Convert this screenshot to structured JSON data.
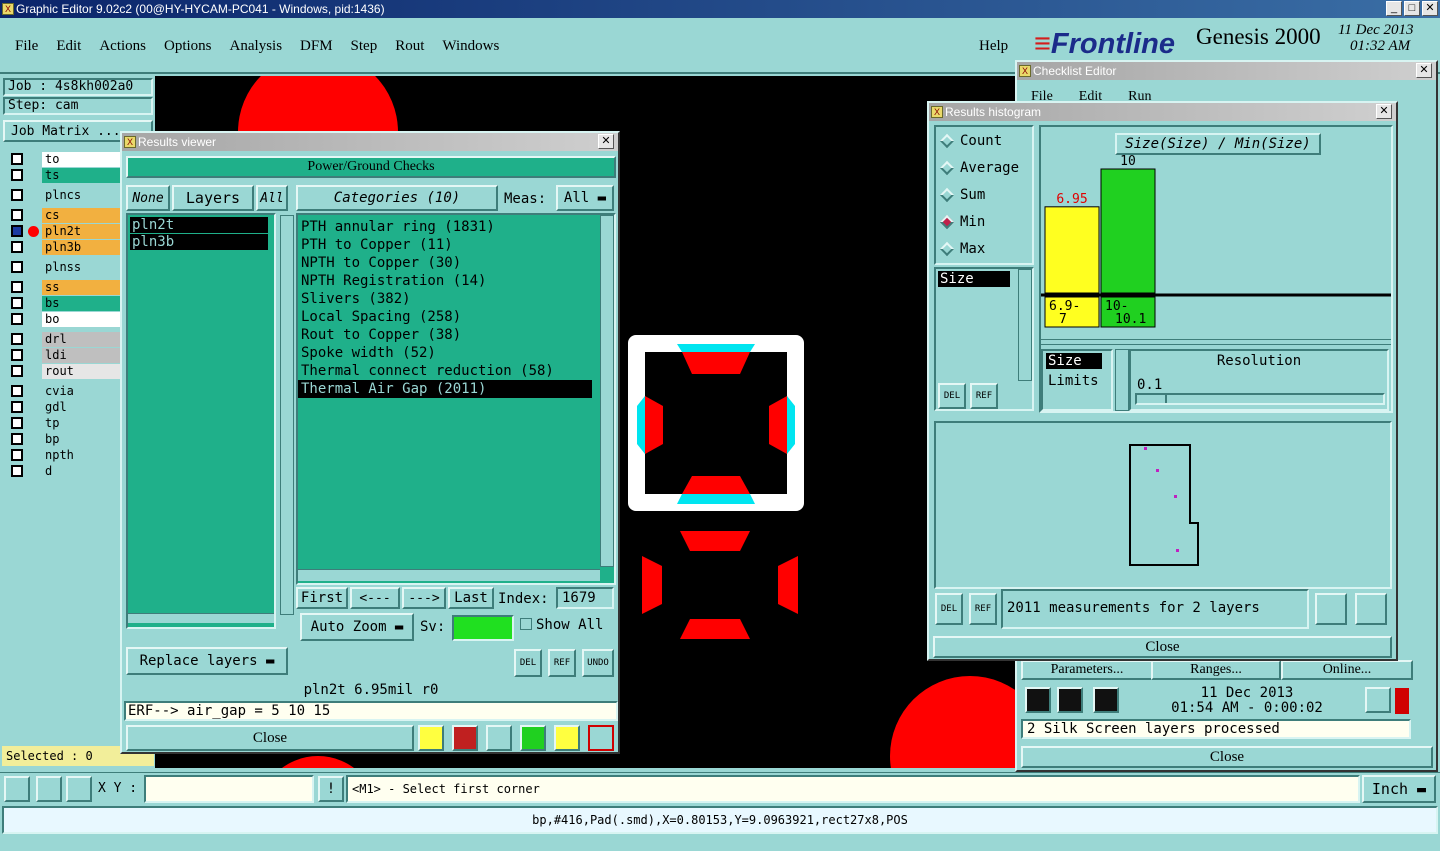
{
  "app": {
    "title": "Graphic Editor 9.02c2 (00@HY-HYCAM-PC041 - Windows, pid:1436)"
  },
  "menu": [
    "File",
    "Edit",
    "Actions",
    "Options",
    "Analysis",
    "DFM",
    "Step",
    "Rout",
    "Windows"
  ],
  "help": "Help",
  "brand": {
    "logo": "Frontline",
    "product": "Genesis 2000",
    "date": "11 Dec 2013",
    "time": "01:32 AM"
  },
  "job": {
    "job_label": "Job : 4s8kh002a0",
    "step_label": "Step: cam",
    "matrix_label": "Job Matrix ..."
  },
  "layers": [
    {
      "name": "to",
      "color": "#ffffff"
    },
    {
      "name": "ts",
      "color": "#1fb08a"
    },
    {
      "name": "plncs",
      "color": "#9ad7d4"
    },
    {
      "name": "cs",
      "color": "#f2b040"
    },
    {
      "name": "pln2t",
      "color": "#f2b040"
    },
    {
      "name": "pln3b",
      "color": "#f2b040"
    },
    {
      "name": "plnss",
      "color": "#9ad7d4"
    },
    {
      "name": "ss",
      "color": "#f2b040"
    },
    {
      "name": "bs",
      "color": "#1fb08a"
    },
    {
      "name": "bo",
      "color": "#ffffff"
    },
    {
      "name": "drl",
      "color": "#bfbfbf"
    },
    {
      "name": "ldi",
      "color": "#bfbfbf"
    },
    {
      "name": "rout",
      "color": "#e6e6e6"
    },
    {
      "name": "cvia",
      "color": "#9ad7d4"
    },
    {
      "name": "gdl",
      "color": "#9ad7d4"
    },
    {
      "name": "tp",
      "color": "#9ad7d4"
    },
    {
      "name": "bp",
      "color": "#9ad7d4"
    },
    {
      "name": "npth",
      "color": "#9ad7d4"
    },
    {
      "name": "d",
      "color": "#9ad7d4"
    }
  ],
  "selected": "Selected : 0",
  "results_viewer": {
    "title": "Results viewer",
    "header": "Power/Ground Checks",
    "none": "None",
    "layers": "Layers",
    "all": "All",
    "categories_label": "Categories (10)",
    "meas_label": "Meas:",
    "meas_value": "All",
    "layer_list": [
      "pln2t",
      "pln3b"
    ],
    "categories": [
      "PTH annular ring (1831)",
      "PTH to Copper (11)",
      "NPTH to Copper (30)",
      "NPTH Registration (14)",
      "Slivers (382)",
      "Local Spacing (258)",
      "Rout to Copper (38)",
      "Spoke width (52)",
      "Thermal connect reduction (58)",
      "Thermal Air Gap (2011)"
    ],
    "selected_category": 9,
    "first": "First",
    "prev": "<---",
    "next": "--->",
    "last": "Last",
    "index_label": "Index:",
    "index_value": "1679",
    "zoom": "Auto Zoom",
    "sv": "Sv:",
    "show_all": "Show All",
    "replace": "Replace layers",
    "del": "DEL",
    "ref": "REF",
    "undo": "UNDO",
    "status": "pln2t 6.95mil  r0",
    "erf": "ERF--> air_gap = 5 10 15",
    "close": "Close"
  },
  "histogram": {
    "title": "Results histogram",
    "modes": [
      "Count",
      "Average",
      "Sum",
      "Min",
      "Max"
    ],
    "selected_mode": "Min",
    "field": "Size",
    "chart_title": "Size(Size) / Min(Size)",
    "bars": [
      {
        "label": "6.9-7",
        "value": 6.95,
        "color": "#ffff20",
        "value_color": "#e00000"
      },
      {
        "label": "10-10.1",
        "value": 10,
        "color": "#20d020",
        "value_color": "#000000"
      }
    ],
    "bar_labels": [
      "6.9-\n7",
      "10-\n10.1"
    ],
    "size_sel": "Size",
    "limits": "Limits",
    "resolution_label": "Resolution",
    "resolution_value": "0.1",
    "measurements": "2011 measurements for 2 layers",
    "close": "Close"
  },
  "checklist": {
    "title": "Checklist Editor",
    "menu": [
      "File",
      "Edit",
      "Run"
    ],
    "buttons": [
      "Parameters...",
      "Ranges...",
      "Online..."
    ],
    "time1": "11 Dec 2013",
    "time2": "01:54 AM - 0:00:02",
    "message": "2 Silk Screen layers processed",
    "close": "Close"
  },
  "bottom": {
    "xy_label": "X Y :",
    "prompt": "<M1> - Select first corner",
    "unit": "Inch",
    "status": "bp,#416,Pad(.smd),X=0.80153,Y=9.0963921,rect27x8,POS"
  }
}
